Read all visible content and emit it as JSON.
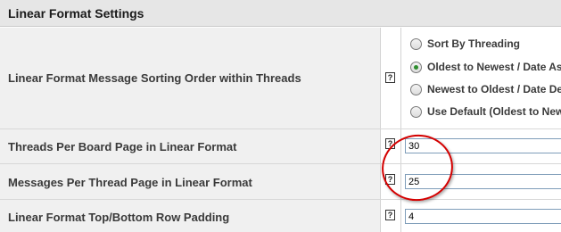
{
  "section": {
    "title": "Linear Format Settings"
  },
  "help_glyph": "?",
  "rows": {
    "sorting": {
      "label": "Linear Format Message Sorting Order within Threads",
      "options": [
        {
          "label": "Sort By Threading",
          "selected": false
        },
        {
          "label": "Oldest to Newest / Date Asc",
          "selected": true
        },
        {
          "label": "Newest to Oldest / Date De",
          "selected": false
        },
        {
          "label": "Use Default  (Oldest to New",
          "selected": false
        }
      ]
    },
    "threads_per_page": {
      "label": "Threads Per Board Page in Linear Format",
      "value": "30"
    },
    "messages_per_page": {
      "label": "Messages Per Thread Page in Linear Format",
      "value": "25"
    },
    "row_padding": {
      "label": "Linear Format Top/Bottom Row Padding",
      "value": "4"
    }
  },
  "colors": {
    "highlight_ellipse": "#d40000",
    "selected_radio": "#2d8d2d",
    "input_border": "#7f9db9"
  },
  "icons": {
    "help": "help-icon",
    "radio_unselected": "radio-unselected-icon",
    "radio_selected": "radio-selected-icon"
  }
}
